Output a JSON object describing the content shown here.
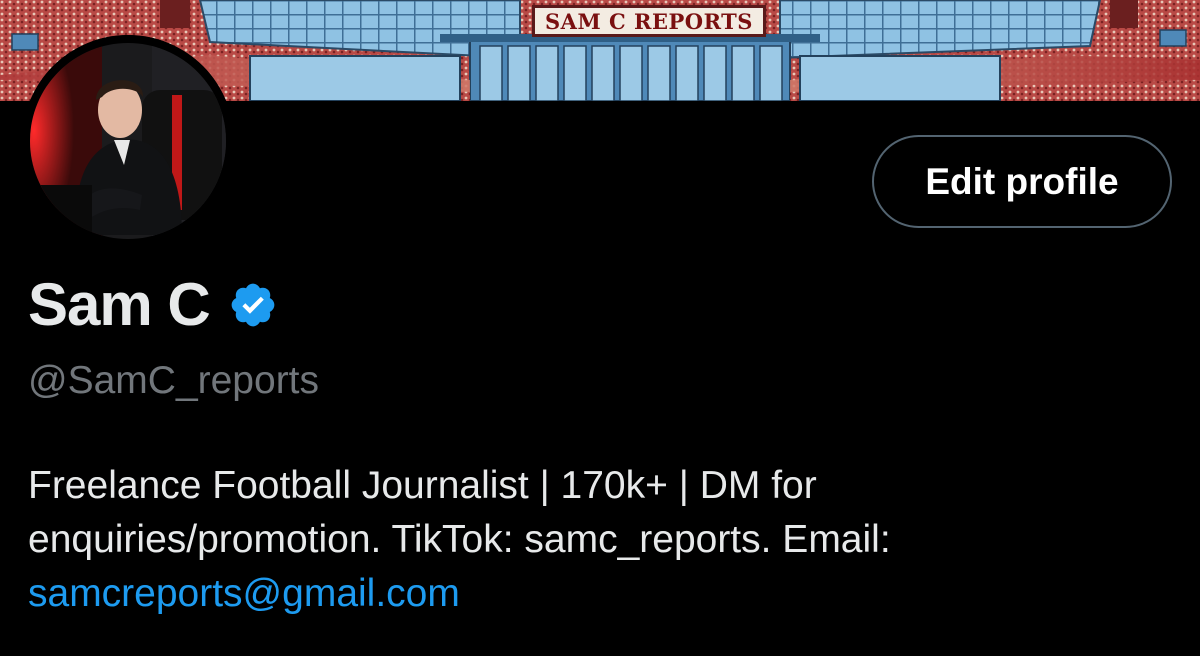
{
  "banner": {
    "sign_text": "SAM C REPORTS",
    "colors": {
      "sky_blue": "#7cb3d9",
      "stand_red": "#a8373a",
      "roof_blue": "#4f89b8"
    }
  },
  "profile": {
    "avatar": {
      "label": "profile-photo"
    },
    "edit_button_label": "Edit profile",
    "display_name": "Sam C",
    "verified_badge": {
      "icon": "verified-check-icon",
      "color": "#1d9bf0"
    },
    "handle": "@SamC_reports",
    "bio": {
      "line1": "Freelance Football Journalist | 170k+ | DM for",
      "line2": "enquiries/promotion. TikTok: samc_reports. Email:",
      "email_link": "samcreports@gmail.com"
    }
  },
  "theme": {
    "background": "#000000",
    "text_primary": "#e7e9ea",
    "text_secondary": "#71767b",
    "link": "#1d9bf0",
    "button_border": "#536471"
  }
}
